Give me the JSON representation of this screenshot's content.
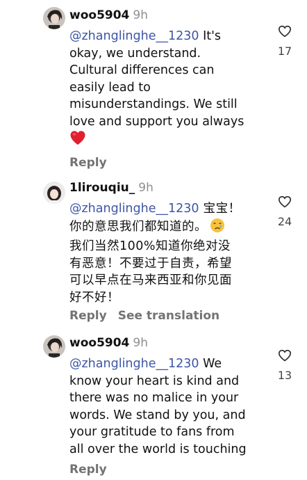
{
  "comments": [
    {
      "username": "woo5904",
      "time": "9h",
      "mention": "@zhanglinghe__1230",
      "lines": [
        " It's",
        "okay, we understand.",
        "Cultural differences can",
        "easily lead to",
        "misunderstandings. We still",
        "love and support you always"
      ],
      "emoji": "red-heart-emoji",
      "likes": "17",
      "reply_label": "Reply"
    },
    {
      "username": "1lirouqiu_",
      "time": "9h",
      "mention": "@zhanglinghe__1230",
      "lines": [
        " 宝宝！",
        "你的意思我们都知道的。",
        "我们当然100%知道你绝对没",
        "有恶意！不要过于自责，希望",
        "可以早点在马来西亚和你见面",
        "好不好！"
      ],
      "emoji": "crying-face-emoji",
      "likes": "24",
      "reply_label": "Reply",
      "translation_label": "See translation"
    },
    {
      "username": "woo5904",
      "time": "9h",
      "mention": "@zhanglinghe__1230",
      "lines": [
        " We",
        "know your heart is kind and",
        "there was no malice in your",
        "words. We stand by you, and",
        "your gratitude to fans from",
        "all over the world is touching"
      ],
      "likes": "13",
      "reply_label": "Reply"
    }
  ],
  "colors": {
    "mention": "#3c55a6",
    "secondary_text": "#737373",
    "heart_emoji": "#e0202f"
  }
}
